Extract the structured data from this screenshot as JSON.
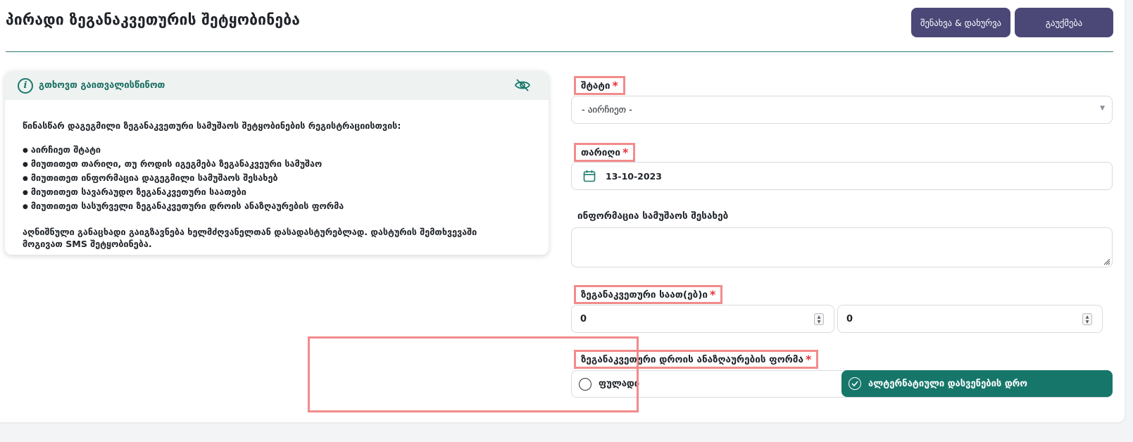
{
  "header": {
    "title": "პირადი ზეგანაკვეთურის შეტყობინება",
    "save_close_label": "შენახვა & დახურვა",
    "cancel_label": "გაუქმება"
  },
  "info_card": {
    "title": "გთხოვთ გაითვალისწინოთ",
    "intro": "წინასწარ დაგეგმილი ზეგანაკვეთური სამუშაოს შეტყობინების რეგისტრაციისთვის:",
    "items": [
      "აირჩიეთ შტატი",
      "მიუთითეთ თარიღი, თუ როდის იგეგმება ზეგანაკვეური სამუშაო",
      "მიუთითეთ ინფორმაცია დაგეგმილი სამუშაოს შესახებ",
      "მიუთითეთ სავარაუდო ზეგანაკვეთური საათები",
      "მიუთითეთ სასურველი ზეგანაკვეთური დროის ანაზღაურების ფორმა"
    ],
    "note_line1": "აღნიშნული განაცხადი გაიგზავნება ხელმძღვანელთან დასადასტურებლად. დასტურის შემთხვევაში",
    "note_line2": "მოგივათ SMS შეტყობინება."
  },
  "form": {
    "staff_label": "შტატი",
    "staff_value": "- აირჩიეთ -",
    "date_label": "თარიღი",
    "date_value": "13-10-2023",
    "info_label": "ინფორმაცია სამუშაოს შესახებ",
    "info_value": "",
    "hours_label": "ზეგანაკვეთური საათ(ებ)ი",
    "hours_value_1": "0",
    "hours_value_2": "0",
    "comp_label": "ზეგანაკვეთური დროის ანაზღაურების ფორმა",
    "comp_option_money": "ფულადი",
    "comp_option_alt": "ალტერნატიული დასვენების დრო",
    "comp_selected": "ალტერნატიული დასვენების დრო",
    "required_mark": "*"
  },
  "colors": {
    "primary_button": "#4b4878",
    "accent_teal": "#16766a",
    "annotation_red": "#f28b8b",
    "required_red": "#e5333a"
  },
  "icons": {
    "info": "info-icon",
    "hide": "eye-off-icon",
    "calendar": "calendar-icon",
    "check": "check-circle-icon"
  }
}
